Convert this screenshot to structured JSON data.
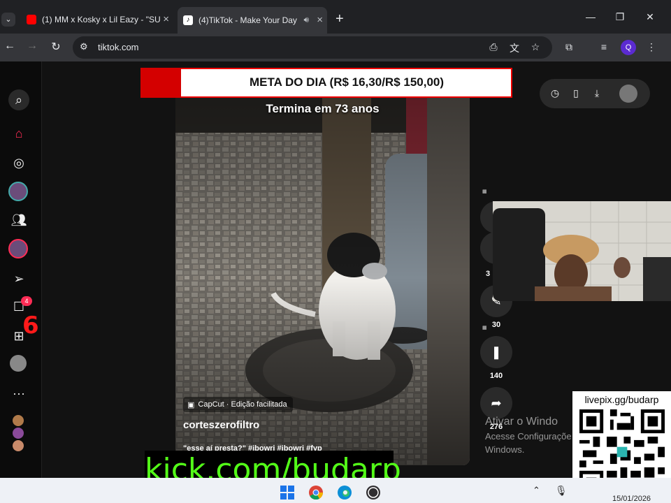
{
  "browser": {
    "tabs": [
      {
        "label": "(1) MM x Kosky x Lil Eazy - \"SU",
        "favicon": "youtube-icon",
        "active": false
      },
      {
        "label": "(4)TikTok - Make Your Day",
        "favicon": "tiktok-icon",
        "active": true
      }
    ],
    "url": "tiktok.com",
    "profile_initial": "Q"
  },
  "sidebar": {
    "messages_badge": "4",
    "overlay_number": "6"
  },
  "goal_banner": {
    "text": "META DO DIA (R$ 16,30/R$ 150,00)"
  },
  "video": {
    "timer_text": "Termina em 73 anos",
    "capcut_label": "CapCut · Edição facilitada",
    "author": "corteszerofiltro",
    "caption": "\"esse aí presta?\" #jbowri #jbowri #fyp"
  },
  "actions": {
    "partial_count": "3",
    "comments": "30",
    "saves": "140",
    "shares": "276"
  },
  "windows_activation": {
    "line1": "Ativar o Windo",
    "line2": "Acesse Configuraçõe",
    "line3": "Windows."
  },
  "qr": {
    "label": "livepix.gg/budarp"
  },
  "kick": {
    "text": "kick.com/budarp"
  },
  "taskbar": {
    "date": "15/01/2026"
  },
  "colors": {
    "tiktok_red": "#fe2c55",
    "kick_green": "#53fc18",
    "goal_red": "#d40000"
  }
}
